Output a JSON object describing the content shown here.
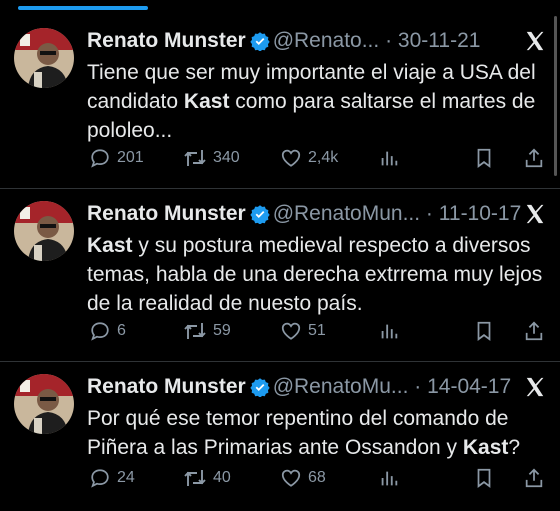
{
  "tweets": [
    {
      "name": "Renato Munster",
      "handle": "@Renato...",
      "date": "30-11-21",
      "text_segments": [
        {
          "t": "Tiene que ser muy importante el viaje a USA del candidato ",
          "b": false
        },
        {
          "t": "Kast",
          "b": true
        },
        {
          "t": " como para saltarse el martes de pololeo...",
          "b": false
        }
      ],
      "replies": "201",
      "retweets": "340",
      "likes": "2,4k"
    },
    {
      "name": "Renato Munster",
      "handle": "@RenatoMun...",
      "date": "11-10-17",
      "text_segments": [
        {
          "t": "Kast",
          "b": true
        },
        {
          "t": " y su postura medieval respecto a diversos temas, habla de una derecha extrrema muy lejos de la realidad de nuesto país.",
          "b": false
        }
      ],
      "replies": "6",
      "retweets": "59",
      "likes": "51"
    },
    {
      "name": "Renato Munster",
      "handle": "@RenatoMu...",
      "date": "14-04-17",
      "text_segments": [
        {
          "t": "Por qué ese temor repentino del comando de Piñera a las Primarias ante Ossandon y ",
          "b": false
        },
        {
          "t": "Kast",
          "b": true
        },
        {
          "t": "?",
          "b": false
        }
      ],
      "replies": "24",
      "retweets": "40",
      "likes": "68"
    }
  ],
  "separator": "·",
  "icons": [
    "reply-icon",
    "retweet-icon",
    "like-icon",
    "views-icon",
    "bookmark-icon",
    "share-icon",
    "verified-badge-icon",
    "x-logo-icon"
  ],
  "colors": {
    "background": "#000000",
    "text": "#e7e9ea",
    "muted": "#8b98a5",
    "accent": "#1d9bf0",
    "divider": "#2f3336"
  }
}
